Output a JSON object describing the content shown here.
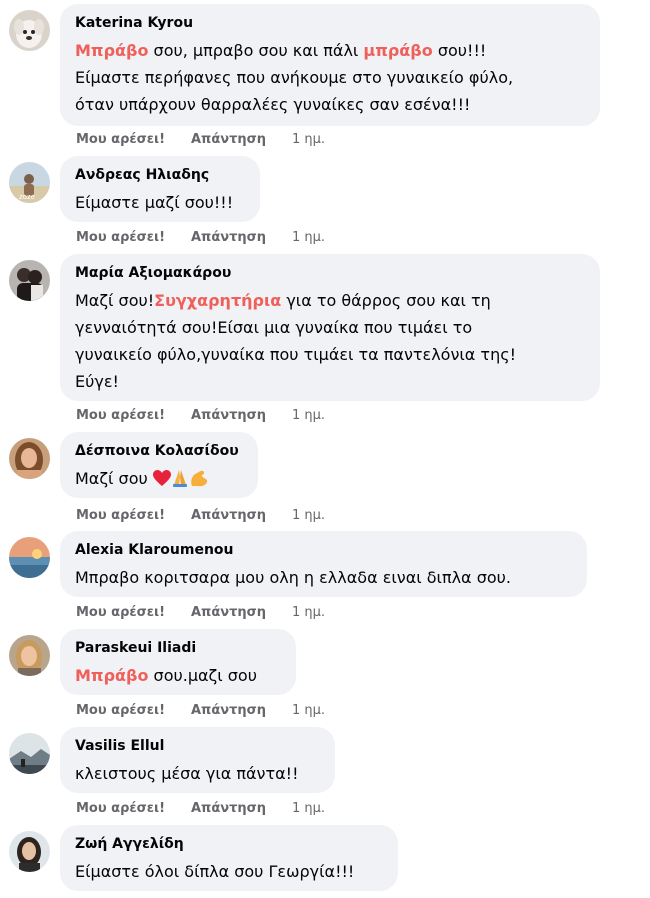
{
  "comments": [
    {
      "author": "Katerina Kyrou",
      "lines": [
        [
          {
            "t": "Μπράβο",
            "hl": true
          },
          {
            "t": " σου, μπραβο σου και πάλι "
          },
          {
            "t": "μπράβο",
            "hl": true
          },
          {
            "t": " σου!!!"
          }
        ],
        [
          {
            "t": "Είμαστε περήφανες που ανήκουμε στο γυναικείο φύλο,"
          }
        ],
        [
          {
            "t": "όταν υπάρχουν θαρραλέες γυναίκες σαν εσένα!!!"
          }
        ]
      ],
      "like": "Μου αρέσει!",
      "reply": "Απάντηση",
      "time": "1 ημ."
    },
    {
      "author": "Ανδρεας Ηλιαδης",
      "lines": [
        [
          {
            "t": "Είμαστε μαζί σου!!!"
          }
        ]
      ],
      "like": "Μου αρέσει!",
      "reply": "Απάντηση",
      "time": "1 ημ."
    },
    {
      "author": "Μαρία Αξιομακάρου",
      "lines": [
        [
          {
            "t": "Μαζί σου!"
          },
          {
            "t": "Συγχαρητήρια",
            "hl": true
          },
          {
            "t": " για το θάρρος σου και τη"
          }
        ],
        [
          {
            "t": "γενναιότητά σου!Είσαι μια γυναίκα που τιμάει το"
          }
        ],
        [
          {
            "t": "γυναικείο φύλο,γυναίκα που τιμάει τα παντελόνια της!"
          }
        ],
        [
          {
            "t": "Εύγε!"
          }
        ]
      ],
      "like": "Μου αρέσει!",
      "reply": "Απάντηση",
      "time": "1 ημ."
    },
    {
      "author": "Δέσποινα Κολασίδου",
      "lines": [
        [
          {
            "t": "Μαζί σου "
          },
          {
            "emoji": "heart"
          },
          {
            "emoji": "pray"
          },
          {
            "emoji": "muscle"
          }
        ]
      ],
      "like": "Μου αρέσει!",
      "reply": "Απάντηση",
      "time": "1 ημ."
    },
    {
      "author": "Alexia Klaroumenou",
      "lines": [
        [
          {
            "t": "Μπραβο κοριτσαρα μου ολη η ελλαδα ειναι διπλα σου."
          }
        ]
      ],
      "like": "Μου αρέσει!",
      "reply": "Απάντηση",
      "time": "1 ημ."
    },
    {
      "author": "Paraskeui Iliadi",
      "lines": [
        [
          {
            "t": "Μπράβο",
            "hl": true
          },
          {
            "t": " σου.μαζι σου"
          }
        ]
      ],
      "like": "Μου αρέσει!",
      "reply": "Απάντηση",
      "time": "1 ημ."
    },
    {
      "author": "Vasilis Ellul",
      "lines": [
        [
          {
            "t": "κλειστους μέσα για πάντα!!"
          }
        ]
      ],
      "like": "Μου αρέσει!",
      "reply": "Απάντηση",
      "time": "1 ημ."
    },
    {
      "author": "Ζωή Αγγελίδη",
      "lines": [
        [
          {
            "t": "Είμαστε όλοι δίπλα σου Γεωργία!!!"
          }
        ]
      ]
    }
  ],
  "avatar_icons": [
    "dog-photo-avatar",
    "beach-photo-avatar",
    "couple-photo-avatar",
    "woman-photo-avatar",
    "sunset-photo-avatar",
    "woman-photo-avatar",
    "landscape-photo-avatar",
    "woman-photo-avatar"
  ],
  "colors": {
    "highlight": "#f0605a",
    "bubble": "#f0f2f5",
    "meta": "#65676b"
  }
}
